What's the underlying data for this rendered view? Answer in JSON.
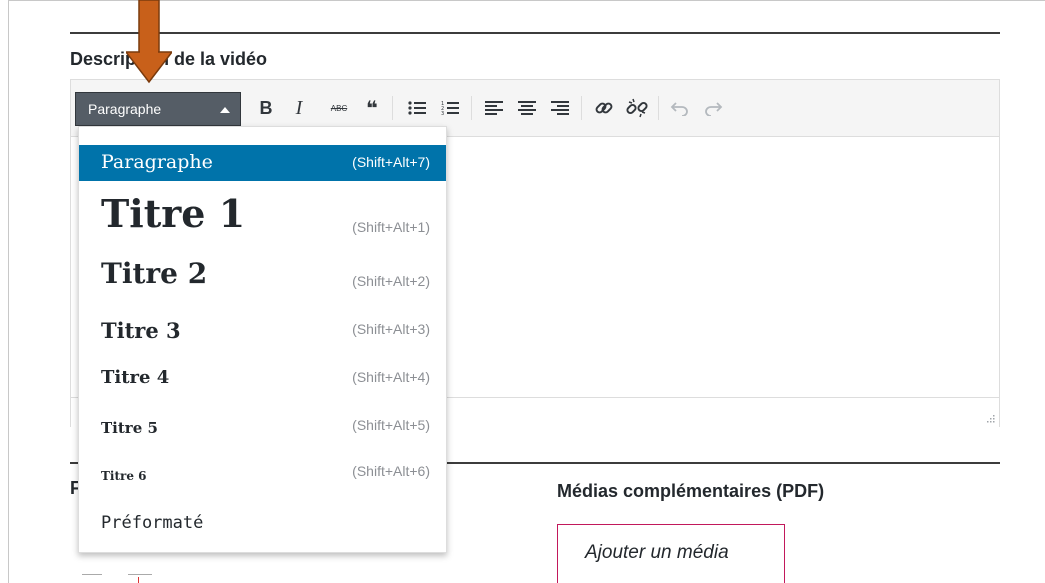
{
  "sections": {
    "description_title": "Description de la vidéo",
    "medias_title": "Médias complémentaires (PDF)",
    "cut_title": "F"
  },
  "toolbar": {
    "format_select_value": "Paragraphe",
    "icons": [
      "bold-icon",
      "italic-icon",
      "strikethrough-icon",
      "blockquote-icon",
      "bullet-list-icon",
      "numbered-list-icon",
      "align-left-icon",
      "align-center-icon",
      "align-right-icon",
      "link-icon",
      "unlink-icon",
      "undo-icon",
      "redo-icon"
    ],
    "bold_glyph": "B",
    "italic_glyph": "I",
    "strike_glyph": "ABC",
    "quote_glyph": "❝"
  },
  "dropdown": {
    "items": [
      {
        "label": "Paragraphe",
        "shortcut": "(Shift+Alt+7)",
        "active": true
      },
      {
        "label": "Titre 1",
        "shortcut": "(Shift+Alt+1)"
      },
      {
        "label": "Titre 2",
        "shortcut": "(Shift+Alt+2)"
      },
      {
        "label": "Titre 3",
        "shortcut": "(Shift+Alt+3)"
      },
      {
        "label": "Titre 4",
        "shortcut": "(Shift+Alt+4)"
      },
      {
        "label": "Titre 5",
        "shortcut": "(Shift+Alt+5)"
      },
      {
        "label": "Titre 6",
        "shortcut": "(Shift+Alt+6)"
      },
      {
        "label": "Préformaté",
        "shortcut": ""
      }
    ]
  },
  "buttons": {
    "add_media": "Ajouter un média"
  },
  "colors": {
    "accent_active": "#0073aa",
    "select_bg": "#555d66",
    "arrow": "#c8601a",
    "button_border": "#c2185b"
  }
}
